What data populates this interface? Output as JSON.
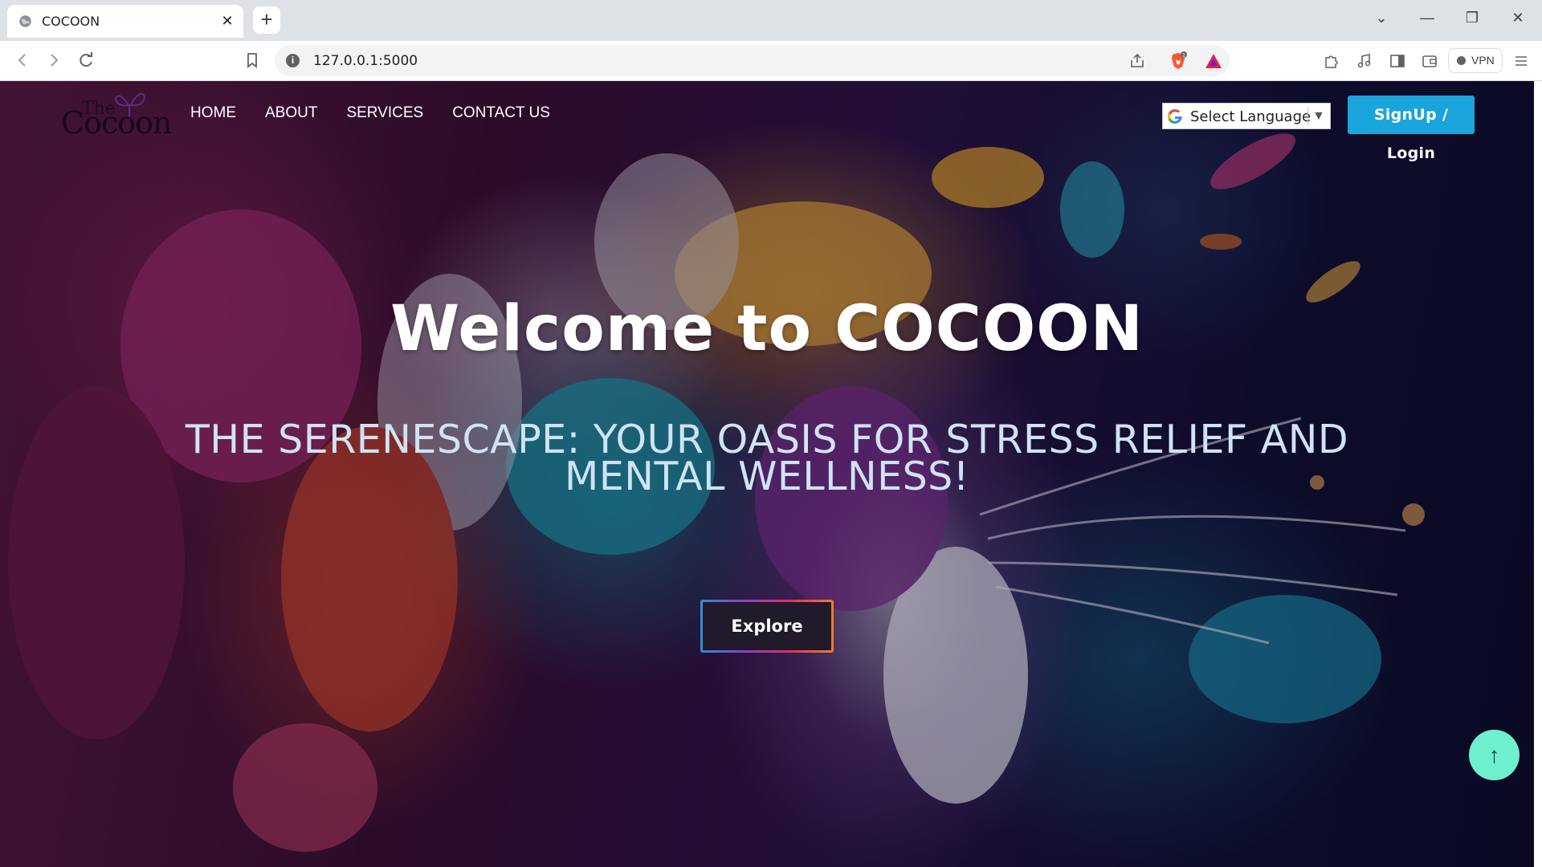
{
  "browser": {
    "tab_title": "COCOON",
    "tab_close": "✕",
    "new_tab": "+",
    "url": "127.0.0.1:5000",
    "vpn_label": "VPN",
    "brave_badge": "1",
    "icons": {
      "back": "back-arrow-icon",
      "forward": "forward-arrow-icon",
      "reload": "reload-icon",
      "bookmark": "bookmark-icon",
      "site_info": "info-icon",
      "share": "share-icon",
      "brave_shields": "brave-lion-icon",
      "rewards": "brave-rewards-triangle-icon",
      "extensions": "puzzle-icon",
      "media": "music-note-icon",
      "sidebar": "sidebar-icon",
      "wallet": "wallet-icon",
      "menu": "hamburger-menu-icon"
    },
    "window": {
      "minimize": "—",
      "restore": "❐",
      "close": "✕",
      "tab_search": "⌄"
    }
  },
  "site": {
    "logo": {
      "small": "The",
      "big": "Cocoon"
    },
    "nav": [
      {
        "label": "HOME"
      },
      {
        "label": "ABOUT"
      },
      {
        "label": "SERVICES"
      },
      {
        "label": "CONTACT US"
      }
    ],
    "language_select": {
      "label": "Select Language",
      "arrow": "▼"
    },
    "signup_label": "SignUp / Login",
    "hero": {
      "title": "Welcome to COCOON",
      "subtitle": "THE SERENESCAPE: YOUR OASIS FOR STRESS RELIEF AND MENTAL WELLNESS!",
      "explore_label": "Explore"
    },
    "scroll_top_icon": "↑"
  },
  "colors": {
    "signup_bg": "#1aa4dc",
    "scroll_top_bg": "#6ef0cf",
    "subtitle": "#cfe3f5"
  }
}
